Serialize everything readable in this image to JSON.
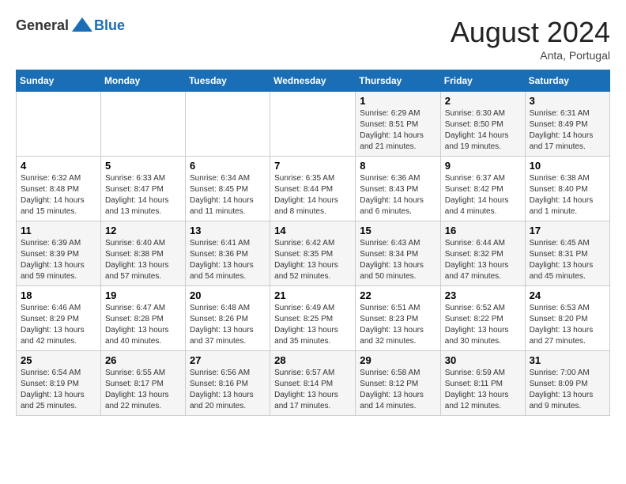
{
  "header": {
    "logo_general": "General",
    "logo_blue": "Blue",
    "month_year": "August 2024",
    "location": "Anta, Portugal"
  },
  "days_of_week": [
    "Sunday",
    "Monday",
    "Tuesday",
    "Wednesday",
    "Thursday",
    "Friday",
    "Saturday"
  ],
  "weeks": [
    [
      {
        "day": "",
        "info": ""
      },
      {
        "day": "",
        "info": ""
      },
      {
        "day": "",
        "info": ""
      },
      {
        "day": "",
        "info": ""
      },
      {
        "day": "1",
        "info": "Sunrise: 6:29 AM\nSunset: 8:51 PM\nDaylight: 14 hours and 21 minutes."
      },
      {
        "day": "2",
        "info": "Sunrise: 6:30 AM\nSunset: 8:50 PM\nDaylight: 14 hours and 19 minutes."
      },
      {
        "day": "3",
        "info": "Sunrise: 6:31 AM\nSunset: 8:49 PM\nDaylight: 14 hours and 17 minutes."
      }
    ],
    [
      {
        "day": "4",
        "info": "Sunrise: 6:32 AM\nSunset: 8:48 PM\nDaylight: 14 hours and 15 minutes."
      },
      {
        "day": "5",
        "info": "Sunrise: 6:33 AM\nSunset: 8:47 PM\nDaylight: 14 hours and 13 minutes."
      },
      {
        "day": "6",
        "info": "Sunrise: 6:34 AM\nSunset: 8:45 PM\nDaylight: 14 hours and 11 minutes."
      },
      {
        "day": "7",
        "info": "Sunrise: 6:35 AM\nSunset: 8:44 PM\nDaylight: 14 hours and 8 minutes."
      },
      {
        "day": "8",
        "info": "Sunrise: 6:36 AM\nSunset: 8:43 PM\nDaylight: 14 hours and 6 minutes."
      },
      {
        "day": "9",
        "info": "Sunrise: 6:37 AM\nSunset: 8:42 PM\nDaylight: 14 hours and 4 minutes."
      },
      {
        "day": "10",
        "info": "Sunrise: 6:38 AM\nSunset: 8:40 PM\nDaylight: 14 hours and 1 minute."
      }
    ],
    [
      {
        "day": "11",
        "info": "Sunrise: 6:39 AM\nSunset: 8:39 PM\nDaylight: 13 hours and 59 minutes."
      },
      {
        "day": "12",
        "info": "Sunrise: 6:40 AM\nSunset: 8:38 PM\nDaylight: 13 hours and 57 minutes."
      },
      {
        "day": "13",
        "info": "Sunrise: 6:41 AM\nSunset: 8:36 PM\nDaylight: 13 hours and 54 minutes."
      },
      {
        "day": "14",
        "info": "Sunrise: 6:42 AM\nSunset: 8:35 PM\nDaylight: 13 hours and 52 minutes."
      },
      {
        "day": "15",
        "info": "Sunrise: 6:43 AM\nSunset: 8:34 PM\nDaylight: 13 hours and 50 minutes."
      },
      {
        "day": "16",
        "info": "Sunrise: 6:44 AM\nSunset: 8:32 PM\nDaylight: 13 hours and 47 minutes."
      },
      {
        "day": "17",
        "info": "Sunrise: 6:45 AM\nSunset: 8:31 PM\nDaylight: 13 hours and 45 minutes."
      }
    ],
    [
      {
        "day": "18",
        "info": "Sunrise: 6:46 AM\nSunset: 8:29 PM\nDaylight: 13 hours and 42 minutes."
      },
      {
        "day": "19",
        "info": "Sunrise: 6:47 AM\nSunset: 8:28 PM\nDaylight: 13 hours and 40 minutes."
      },
      {
        "day": "20",
        "info": "Sunrise: 6:48 AM\nSunset: 8:26 PM\nDaylight: 13 hours and 37 minutes."
      },
      {
        "day": "21",
        "info": "Sunrise: 6:49 AM\nSunset: 8:25 PM\nDaylight: 13 hours and 35 minutes."
      },
      {
        "day": "22",
        "info": "Sunrise: 6:51 AM\nSunset: 8:23 PM\nDaylight: 13 hours and 32 minutes."
      },
      {
        "day": "23",
        "info": "Sunrise: 6:52 AM\nSunset: 8:22 PM\nDaylight: 13 hours and 30 minutes."
      },
      {
        "day": "24",
        "info": "Sunrise: 6:53 AM\nSunset: 8:20 PM\nDaylight: 13 hours and 27 minutes."
      }
    ],
    [
      {
        "day": "25",
        "info": "Sunrise: 6:54 AM\nSunset: 8:19 PM\nDaylight: 13 hours and 25 minutes."
      },
      {
        "day": "26",
        "info": "Sunrise: 6:55 AM\nSunset: 8:17 PM\nDaylight: 13 hours and 22 minutes."
      },
      {
        "day": "27",
        "info": "Sunrise: 6:56 AM\nSunset: 8:16 PM\nDaylight: 13 hours and 20 minutes."
      },
      {
        "day": "28",
        "info": "Sunrise: 6:57 AM\nSunset: 8:14 PM\nDaylight: 13 hours and 17 minutes."
      },
      {
        "day": "29",
        "info": "Sunrise: 6:58 AM\nSunset: 8:12 PM\nDaylight: 13 hours and 14 minutes."
      },
      {
        "day": "30",
        "info": "Sunrise: 6:59 AM\nSunset: 8:11 PM\nDaylight: 13 hours and 12 minutes."
      },
      {
        "day": "31",
        "info": "Sunrise: 7:00 AM\nSunset: 8:09 PM\nDaylight: 13 hours and 9 minutes."
      }
    ]
  ]
}
